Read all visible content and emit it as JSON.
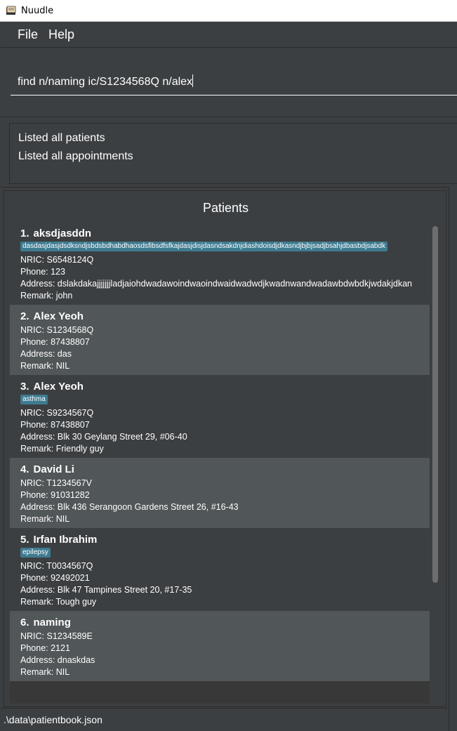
{
  "window": {
    "title": "Nuudle"
  },
  "menu": {
    "file": "File",
    "help": "Help"
  },
  "command": {
    "value": "find n/naming ic/S1234568Q n/alex"
  },
  "result": {
    "lines": [
      "Listed all patients",
      "Listed all appointments"
    ]
  },
  "list": {
    "title": "Patients",
    "patients": [
      {
        "index": "1.",
        "name": "aksdjasddn",
        "tags": [
          "dasdasjdasjdsdksndjsbdsbdhabdhaosdsfibsdfsfkajdasjdisjdasndsakdnjdiashdoisdjdkasndjbjbjsadjbsahjdbasbdjsabdk"
        ],
        "nric": "NRIC: S6548124Q",
        "phone": "Phone: 123",
        "address": "Address: dslakdakajjjjjjjladjaiohdwadawoindwaoindwaidwadwdjkwadnwandwadawbdwbdkjwdakjdkan",
        "remark": "Remark: john"
      },
      {
        "index": "2.",
        "name": "Alex Yeoh",
        "tags": [],
        "nric": "NRIC: S1234568Q",
        "phone": "Phone: 87438807",
        "address": "Address: das",
        "remark": "Remark: NIL"
      },
      {
        "index": "3.",
        "name": "Alex Yeoh",
        "tags": [
          "asthma"
        ],
        "nric": "NRIC: S9234567Q",
        "phone": "Phone: 87438807",
        "address": "Address: Blk 30 Geylang Street 29, #06-40",
        "remark": "Remark: Friendly guy"
      },
      {
        "index": "4.",
        "name": "David Li",
        "tags": [],
        "nric": "NRIC: T1234567V",
        "phone": "Phone: 91031282",
        "address": "Address: Blk 436 Serangoon Gardens Street 26, #16-43",
        "remark": "Remark: NIL"
      },
      {
        "index": "5.",
        "name": "Irfan Ibrahim",
        "tags": [
          "epilepsy"
        ],
        "nric": "NRIC: T0034567Q",
        "phone": "Phone: 92492021",
        "address": "Address: Blk 47 Tampines Street 20, #17-35",
        "remark": "Remark: Tough guy"
      },
      {
        "index": "6.",
        "name": "naming",
        "tags": [],
        "nric": "NRIC: S1234589E",
        "phone": "Phone: 2121",
        "address": "Address: dnaskdas",
        "remark": "Remark: NIL"
      }
    ]
  },
  "status": {
    "path": ".\\data\\patientbook.json"
  },
  "colors": {
    "background": "#3c3f41",
    "card_alt": "#515658",
    "tag": "#3e7b91",
    "text": "#ffffff"
  },
  "icons": {
    "app": "app-book-icon"
  }
}
